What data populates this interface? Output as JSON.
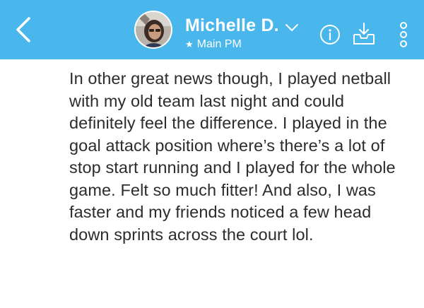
{
  "header": {
    "contact_name": "Michelle D.",
    "subtitle": "Main PM",
    "star_glyph": "★",
    "background_color": "#49b6ec",
    "icons": [
      "back-arrow-icon",
      "chevron-down-icon",
      "info-icon",
      "inbox-download-icon",
      "more-vertical-icon"
    ]
  },
  "message": {
    "text": "In other great news though, I played netball with my old team last night and could definitely feel the difference. I played in the goal attack position where’s there’s a lot of stop start running and I played for the whole game. Felt so much fitter! And also, I was faster and my friends noticed a few head down sprints across the court lol."
  }
}
